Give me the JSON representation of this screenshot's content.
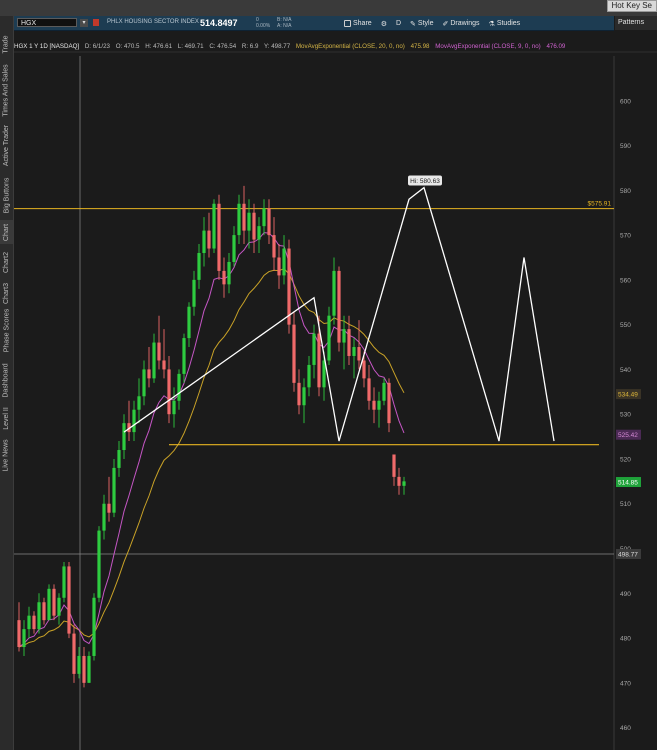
{
  "window": {
    "hotkey_label": "Hot Key Se"
  },
  "sidebar": {
    "tabs": [
      {
        "label": "Trade",
        "center": 44,
        "h": 30
      },
      {
        "label": "Times And Sales",
        "center": 90,
        "h": 56
      },
      {
        "label": "Active Trader",
        "center": 145,
        "h": 46
      },
      {
        "label": "Big Buttons",
        "center": 195,
        "h": 44
      },
      {
        "label": "Chart",
        "center": 232,
        "h": 24,
        "active": true
      },
      {
        "label": "Chart2",
        "center": 262,
        "h": 26
      },
      {
        "label": "Chart3",
        "center": 293,
        "h": 26
      },
      {
        "label": "Phase Scores",
        "center": 330,
        "h": 44
      },
      {
        "label": "Dashboard",
        "center": 380,
        "h": 40
      },
      {
        "label": "Level II",
        "center": 418,
        "h": 28
      },
      {
        "label": "Live News",
        "center": 455,
        "h": 36
      }
    ]
  },
  "header": {
    "symbol": "HGX",
    "description": "PHLX HOUSING SECTOR INDEX",
    "last_price": "514.8497",
    "change": "0",
    "change_pct": "0.00%",
    "bid": "B: N/A",
    "ask": "A: N/A",
    "toolbar": [
      {
        "label": "Share",
        "icon": "share-icon"
      },
      {
        "label": "",
        "icon": "gear-icon"
      },
      {
        "label": "D",
        "icon": ""
      },
      {
        "label": "Style",
        "icon": "style-icon"
      },
      {
        "label": "Drawings",
        "icon": "drawings-icon"
      },
      {
        "label": "Studies",
        "icon": "studies-icon"
      }
    ],
    "patterns_label": "Patterns"
  },
  "infobar": {
    "title": "HGX 1 Y 1D [NASDAQ]",
    "quote": [
      "D: 6/1/23",
      "O: 470.5",
      "H: 476.61",
      "L: 469.71",
      "C: 476.54",
      "R: 6.9",
      "Y: 498.77"
    ],
    "ema20_label": "MovAvgExponential (CLOSE, 20, 0, no)",
    "ema20_value": "475.98",
    "ema9_label": "MovAvgExponential (CLOSE, 9, 0, no)",
    "ema9_value": "476.09"
  },
  "colors": {
    "background": "#1b1b1b",
    "up_candle": "#2ecc40",
    "down_candle": "#f06a6a",
    "ema20": "#c9a227",
    "ema9": "#c556c5",
    "pattern_line": "#ffffff",
    "resistance": "#e6b422",
    "neckline": "#e6b422",
    "last_price_tag": "#1fa33a",
    "ema9_tag": "#7a2b8a",
    "ema20_tag": "#3a3a3a"
  },
  "chart_data": {
    "type": "candlestick",
    "x_label": "",
    "y_label": "",
    "ylim": [
      455,
      610
    ],
    "y_ticks": [
      460,
      470,
      480,
      490,
      500,
      510,
      520,
      530,
      540,
      550,
      560,
      570,
      580,
      590,
      600
    ],
    "crosshair_price": 498.77,
    "resistance_level": 575.91,
    "resistance_label": "$575.91",
    "neckline_level": 523.2,
    "high_marker": {
      "label": "Hi: 580.63",
      "value": 580.63
    },
    "price_tags": [
      {
        "value": 534.49,
        "label": "534.49",
        "kind": "ema20"
      },
      {
        "value": 525.42,
        "label": "525.42",
        "kind": "ema9"
      },
      {
        "value": 514.85,
        "label": "514.85",
        "kind": "last"
      },
      {
        "value": 498.77,
        "label": "498.77",
        "kind": "crosshair"
      }
    ],
    "pattern_points": [
      [
        0,
        526
      ],
      [
        38,
        556
      ],
      [
        43,
        524
      ],
      [
        57,
        578
      ],
      [
        60,
        580.6
      ],
      [
        75,
        524
      ],
      [
        80,
        565
      ],
      [
        86,
        524
      ]
    ],
    "pattern_extension_x": 116,
    "candles": [
      [
        484,
        488,
        477,
        478
      ],
      [
        478,
        484,
        476,
        482
      ],
      [
        482,
        487,
        480,
        485
      ],
      [
        485,
        486,
        481,
        482
      ],
      [
        482,
        490,
        481,
        488
      ],
      [
        488,
        489,
        483,
        484
      ],
      [
        484,
        492,
        484,
        491
      ],
      [
        491,
        492,
        484,
        485
      ],
      [
        485,
        490,
        483,
        489
      ],
      [
        489,
        497,
        488,
        496
      ],
      [
        496,
        497,
        480,
        481
      ],
      [
        481,
        483,
        470,
        472
      ],
      [
        472,
        478,
        471,
        476
      ],
      [
        476,
        478,
        469,
        470
      ],
      [
        470,
        477,
        470,
        476
      ],
      [
        476,
        490,
        475,
        489
      ],
      [
        489,
        505,
        488,
        504
      ],
      [
        504,
        512,
        502,
        510
      ],
      [
        510,
        516,
        506,
        508
      ],
      [
        508,
        520,
        507,
        518
      ],
      [
        518,
        524,
        516,
        522
      ],
      [
        522,
        530,
        520,
        528
      ],
      [
        528,
        533,
        524,
        526
      ],
      [
        526,
        533,
        524,
        531
      ],
      [
        531,
        538,
        528,
        534
      ],
      [
        534,
        542,
        532,
        540
      ],
      [
        540,
        545,
        536,
        538
      ],
      [
        538,
        548,
        537,
        546
      ],
      [
        546,
        552,
        540,
        542
      ],
      [
        542,
        549,
        538,
        540
      ],
      [
        540,
        543,
        528,
        530
      ],
      [
        530,
        536,
        527,
        533
      ],
      [
        533,
        540,
        531,
        539
      ],
      [
        539,
        548,
        537,
        547
      ],
      [
        547,
        555,
        545,
        554
      ],
      [
        554,
        562,
        552,
        560
      ],
      [
        560,
        568,
        558,
        566
      ],
      [
        566,
        574,
        563,
        571
      ],
      [
        571,
        575,
        565,
        567
      ],
      [
        567,
        578,
        566,
        577
      ],
      [
        577,
        579,
        560,
        562
      ],
      [
        562,
        565,
        556,
        559
      ],
      [
        559,
        566,
        557,
        564
      ],
      [
        564,
        572,
        563,
        570
      ],
      [
        570,
        579,
        568,
        577
      ],
      [
        577,
        581,
        568,
        571
      ],
      [
        571,
        578,
        567,
        575
      ],
      [
        575,
        577,
        566,
        569
      ],
      [
        569,
        574,
        566,
        572
      ],
      [
        572,
        578,
        570,
        576
      ],
      [
        576,
        578,
        568,
        570
      ],
      [
        570,
        574,
        562,
        565
      ],
      [
        565,
        568,
        558,
        561
      ],
      [
        561,
        570,
        559,
        567
      ],
      [
        567,
        569,
        548,
        550
      ],
      [
        550,
        553,
        535,
        537
      ],
      [
        537,
        540,
        530,
        532
      ],
      [
        532,
        538,
        528,
        536
      ],
      [
        536,
        543,
        534,
        541
      ],
      [
        541,
        550,
        538,
        548
      ],
      [
        548,
        552,
        534,
        536
      ],
      [
        536,
        544,
        533,
        542
      ],
      [
        542,
        554,
        541,
        552
      ],
      [
        552,
        565,
        550,
        562
      ],
      [
        562,
        563,
        544,
        546
      ],
      [
        546,
        552,
        540,
        549
      ],
      [
        549,
        552,
        541,
        543
      ],
      [
        543,
        547,
        538,
        545
      ],
      [
        545,
        551,
        540,
        542
      ],
      [
        542,
        544,
        536,
        538
      ],
      [
        538,
        541,
        531,
        533
      ],
      [
        533,
        536,
        528,
        531
      ],
      [
        531,
        535,
        527,
        533
      ],
      [
        533,
        538,
        532,
        537
      ],
      [
        537,
        538,
        526,
        528
      ],
      [
        521,
        521,
        514,
        516
      ],
      [
        516,
        518,
        512,
        514
      ],
      [
        514,
        516,
        512,
        515
      ]
    ]
  }
}
